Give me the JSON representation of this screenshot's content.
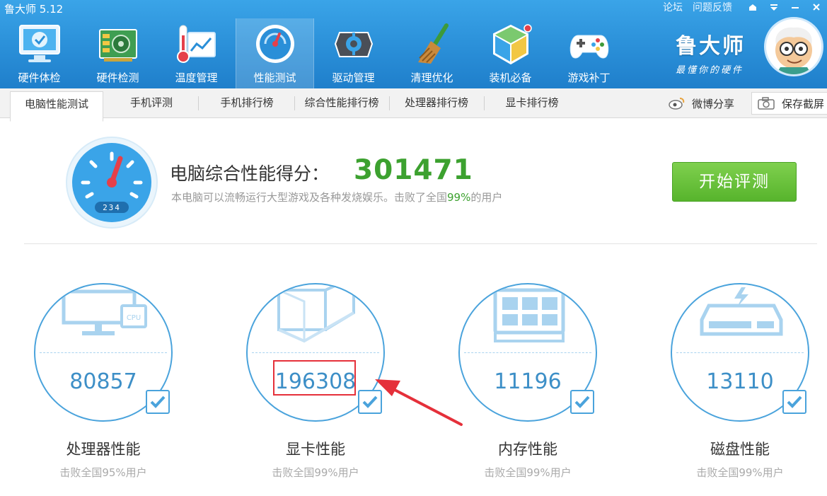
{
  "app": {
    "title": "鲁大师 5.12"
  },
  "window": {
    "forum": "论坛",
    "feedback": "问题反馈"
  },
  "nav": [
    {
      "label": "硬件体检",
      "icon": "monitor-check-icon"
    },
    {
      "label": "硬件检测",
      "icon": "circuit-board-icon"
    },
    {
      "label": "温度管理",
      "icon": "thermometer-chart-icon"
    },
    {
      "label": "性能测试",
      "icon": "speedometer-icon"
    },
    {
      "label": "驱动管理",
      "icon": "driver-gear-icon"
    },
    {
      "label": "清理优化",
      "icon": "broom-icon"
    },
    {
      "label": "装机必备",
      "icon": "package-cube-icon"
    },
    {
      "label": "游戏补丁",
      "icon": "gamepad-icon"
    }
  ],
  "brand": {
    "name": "鲁大师",
    "slogan": "最懂你的硬件"
  },
  "tabs": [
    "电脑性能测试",
    "手机评测",
    "手机排行榜",
    "综合性能排行榜",
    "处理器排行榜",
    "显卡排行榜"
  ],
  "actions": {
    "share": "微博分享",
    "save_screenshot": "保存截屏"
  },
  "score": {
    "title": "电脑综合性能得分：",
    "value": "301471",
    "desc_prefix": "本电脑可以流畅运行大型游戏及各种发烧娱乐。击败了全国",
    "desc_pct": "99%",
    "desc_suffix": "的用户",
    "gauge_readout": "234"
  },
  "start_button": "开始评测",
  "cards": [
    {
      "name": "处理器性能",
      "score": "80857",
      "sub": "击败全国95%用户",
      "icon": "cpu-monitor-icon"
    },
    {
      "name": "显卡性能",
      "score": "196308",
      "sub": "击败全国99%用户",
      "icon": "graphics-cube-icon"
    },
    {
      "name": "内存性能",
      "score": "11196",
      "sub": "击败全国99%用户",
      "icon": "memory-chip-icon"
    },
    {
      "name": "磁盘性能",
      "score": "13110",
      "sub": "击败全国99%用户",
      "icon": "disk-drive-icon"
    }
  ],
  "colors": {
    "accent_blue": "#2a8fd8",
    "score_green": "#3ca12f",
    "highlight_red": "#e5303a",
    "card_blue": "#4aa3dc"
  }
}
